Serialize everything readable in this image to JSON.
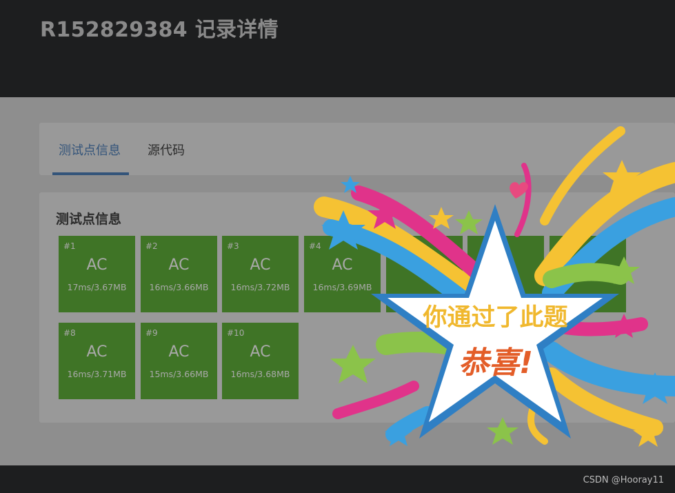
{
  "header": {
    "title": "R152829384 记录详情"
  },
  "tabs": [
    {
      "label": "测试点信息"
    },
    {
      "label": "源代码"
    }
  ],
  "info": {
    "title": "测试点信息",
    "tiles": [
      {
        "id": "#1",
        "status": "AC",
        "detail": "17ms/3.67MB"
      },
      {
        "id": "#2",
        "status": "AC",
        "detail": "16ms/3.66MB"
      },
      {
        "id": "#3",
        "status": "AC",
        "detail": "16ms/3.72MB"
      },
      {
        "id": "#4",
        "status": "AC",
        "detail": "16ms/3.69MB"
      },
      {
        "id": "#8",
        "status": "AC",
        "detail": "16ms/3.71MB"
      },
      {
        "id": "#9",
        "status": "AC",
        "detail": "15ms/3.66MB"
      },
      {
        "id": "#10",
        "status": "AC",
        "detail": "16ms/3.68MB"
      }
    ]
  },
  "overlay": {
    "line1": "你通过了此题",
    "line2": "恭喜!"
  },
  "footer": {
    "watermark": "CSDN @Hooray11"
  },
  "colors": {
    "header_bg": "#1d1e1f",
    "page_bg": "#8e8e8e",
    "card_bg": "#999999",
    "accent": "#33547a",
    "tile_bg": "#3f7426",
    "congrats_yellow": "#f0b82e",
    "congrats_orange": "#e35d28"
  }
}
